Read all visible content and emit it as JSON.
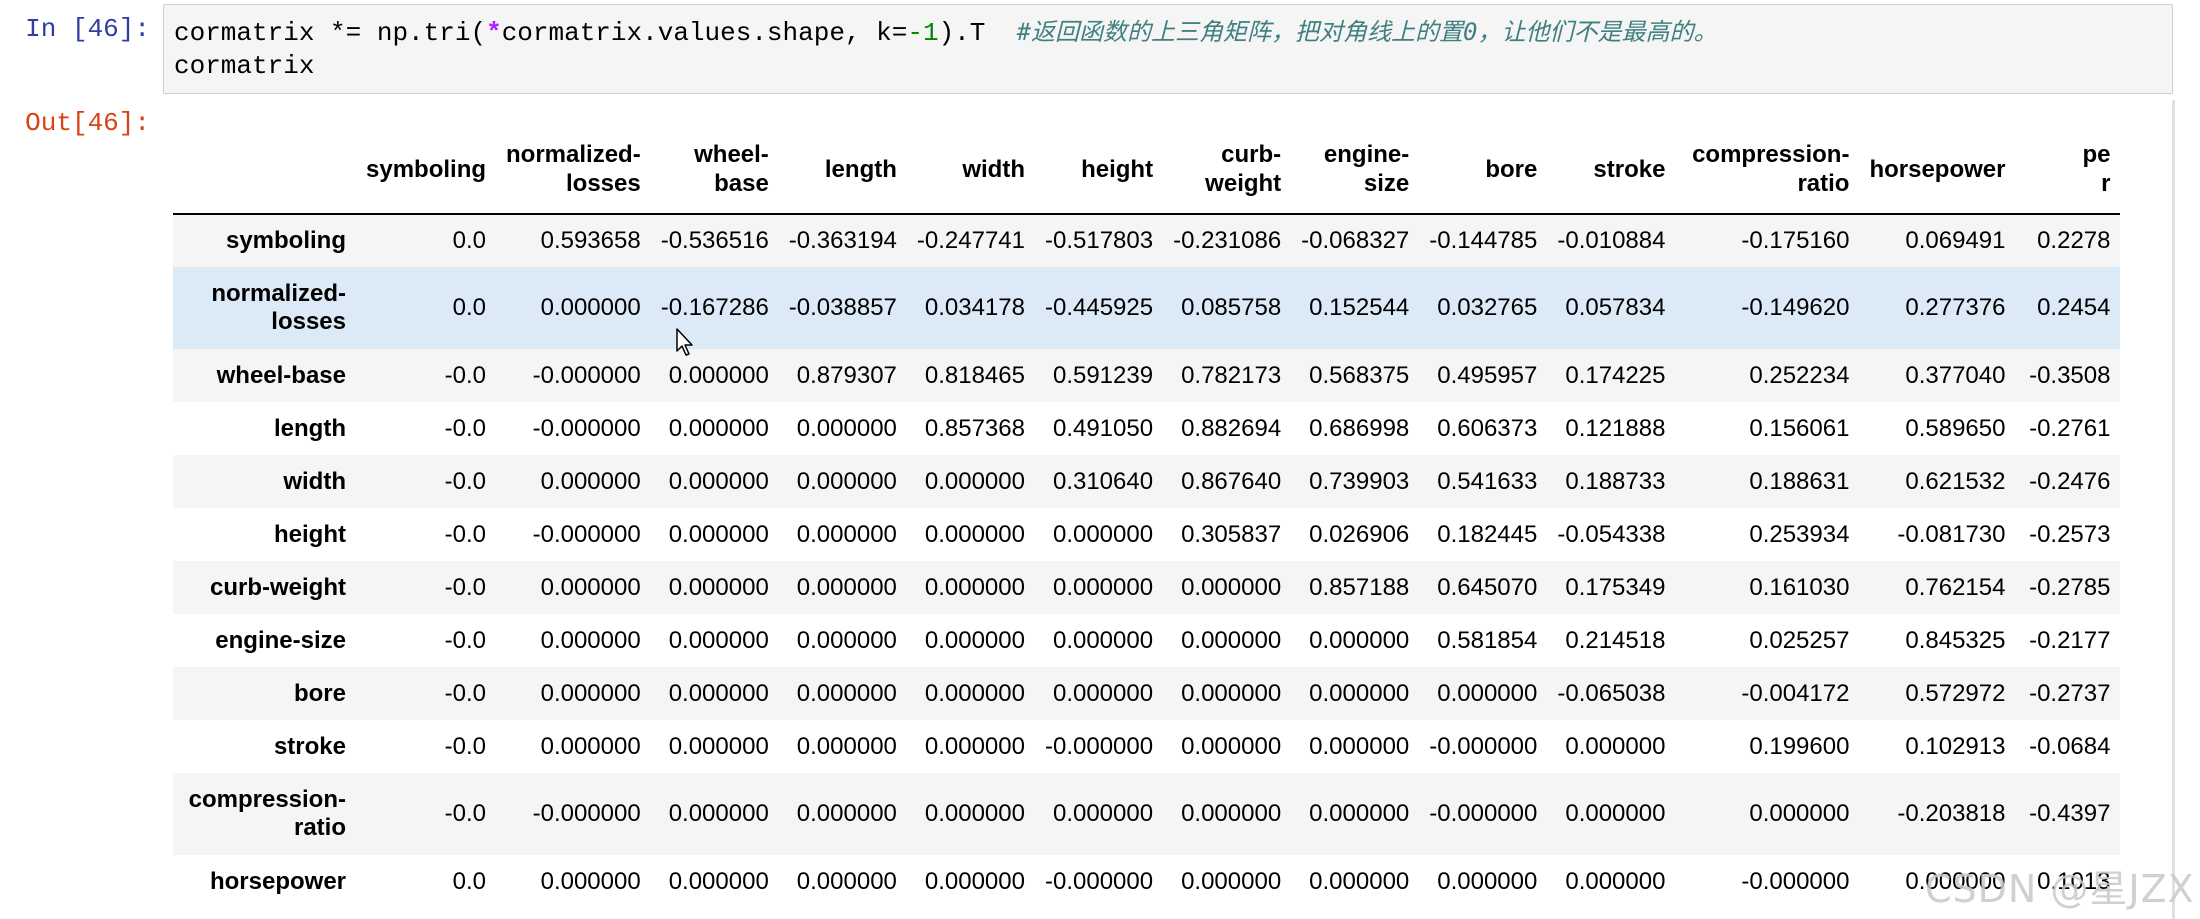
{
  "cell": {
    "in_prompt": "In [46]:",
    "out_prompt": "Out[46]:",
    "code_line1_a": "cormatrix ",
    "code_line1_op": "*=",
    "code_line1_b": " np.tri(",
    "code_line1_star": "*",
    "code_line1_c": "cormatrix.values.shape, k=",
    "code_line1_num": "-1",
    "code_line1_d": ").T  ",
    "code_line1_comment": "#返回函数的上三角矩阵，把对角线上的置0，让他们不是最高的。",
    "code_line2": "cormatrix"
  },
  "table": {
    "columns": [
      [
        "symboling"
      ],
      [
        "normalized-",
        "losses"
      ],
      [
        "wheel-",
        "base"
      ],
      [
        "length"
      ],
      [
        "width"
      ],
      [
        "height"
      ],
      [
        "curb-",
        "weight"
      ],
      [
        "engine-",
        "size"
      ],
      [
        "bore"
      ],
      [
        "stroke"
      ],
      [
        "compression-",
        "ratio"
      ],
      [
        "horsepower"
      ],
      [
        "pe",
        "r"
      ]
    ],
    "rows": [
      {
        "label": [
          "symboling"
        ],
        "values": [
          "0.0",
          "0.593658",
          "-0.536516",
          "-0.363194",
          "-0.247741",
          "-0.517803",
          "-0.231086",
          "-0.068327",
          "-0.144785",
          "-0.010884",
          "-0.175160",
          "0.069491",
          "0.2278"
        ]
      },
      {
        "label": [
          "normalized-",
          "losses"
        ],
        "values": [
          "0.0",
          "0.000000",
          "-0.167286",
          "-0.038857",
          "0.034178",
          "-0.445925",
          "0.085758",
          "0.152544",
          "0.032765",
          "0.057834",
          "-0.149620",
          "0.277376",
          "0.2454"
        ]
      },
      {
        "label": [
          "wheel-base"
        ],
        "values": [
          "-0.0",
          "-0.000000",
          "0.000000",
          "0.879307",
          "0.818465",
          "0.591239",
          "0.782173",
          "0.568375",
          "0.495957",
          "0.174225",
          "0.252234",
          "0.377040",
          "-0.3508"
        ]
      },
      {
        "label": [
          "length"
        ],
        "values": [
          "-0.0",
          "-0.000000",
          "0.000000",
          "0.000000",
          "0.857368",
          "0.491050",
          "0.882694",
          "0.686998",
          "0.606373",
          "0.121888",
          "0.156061",
          "0.589650",
          "-0.2761"
        ]
      },
      {
        "label": [
          "width"
        ],
        "values": [
          "-0.0",
          "0.000000",
          "0.000000",
          "0.000000",
          "0.000000",
          "0.310640",
          "0.867640",
          "0.739903",
          "0.541633",
          "0.188733",
          "0.188631",
          "0.621532",
          "-0.2476"
        ]
      },
      {
        "label": [
          "height"
        ],
        "values": [
          "-0.0",
          "-0.000000",
          "0.000000",
          "0.000000",
          "0.000000",
          "0.000000",
          "0.305837",
          "0.026906",
          "0.182445",
          "-0.054338",
          "0.253934",
          "-0.081730",
          "-0.2573"
        ]
      },
      {
        "label": [
          "curb-weight"
        ],
        "values": [
          "-0.0",
          "0.000000",
          "0.000000",
          "0.000000",
          "0.000000",
          "0.000000",
          "0.000000",
          "0.857188",
          "0.645070",
          "0.175349",
          "0.161030",
          "0.762154",
          "-0.2785"
        ]
      },
      {
        "label": [
          "engine-size"
        ],
        "values": [
          "-0.0",
          "0.000000",
          "0.000000",
          "0.000000",
          "0.000000",
          "0.000000",
          "0.000000",
          "0.000000",
          "0.581854",
          "0.214518",
          "0.025257",
          "0.845325",
          "-0.2177"
        ]
      },
      {
        "label": [
          "bore"
        ],
        "values": [
          "-0.0",
          "0.000000",
          "0.000000",
          "0.000000",
          "0.000000",
          "0.000000",
          "0.000000",
          "0.000000",
          "0.000000",
          "-0.065038",
          "-0.004172",
          "0.572972",
          "-0.2737"
        ]
      },
      {
        "label": [
          "stroke"
        ],
        "values": [
          "-0.0",
          "0.000000",
          "0.000000",
          "0.000000",
          "0.000000",
          "-0.000000",
          "0.000000",
          "0.000000",
          "-0.000000",
          "0.000000",
          "0.199600",
          "0.102913",
          "-0.0684"
        ]
      },
      {
        "label": [
          "compression-",
          "ratio"
        ],
        "values": [
          "-0.0",
          "-0.000000",
          "0.000000",
          "0.000000",
          "0.000000",
          "0.000000",
          "0.000000",
          "0.000000",
          "-0.000000",
          "0.000000",
          "0.000000",
          "-0.203818",
          "-0.4397"
        ]
      },
      {
        "label": [
          "horsepower"
        ],
        "values": [
          "0.0",
          "0.000000",
          "0.000000",
          "0.000000",
          "0.000000",
          "-0.000000",
          "0.000000",
          "0.000000",
          "0.000000",
          "0.000000",
          "-0.000000",
          "0.000000",
          "0.1013"
        ]
      }
    ],
    "highlighted_row_index": 1
  },
  "watermark": "CSDN @星JZX",
  "colors": {
    "in_prompt": "#303f9f",
    "out_prompt": "#d84315",
    "row_highlight": "#dce9f7",
    "row_stripe": "#f5f5f5"
  },
  "icons": {
    "cursor": "mouse-pointer-icon"
  }
}
